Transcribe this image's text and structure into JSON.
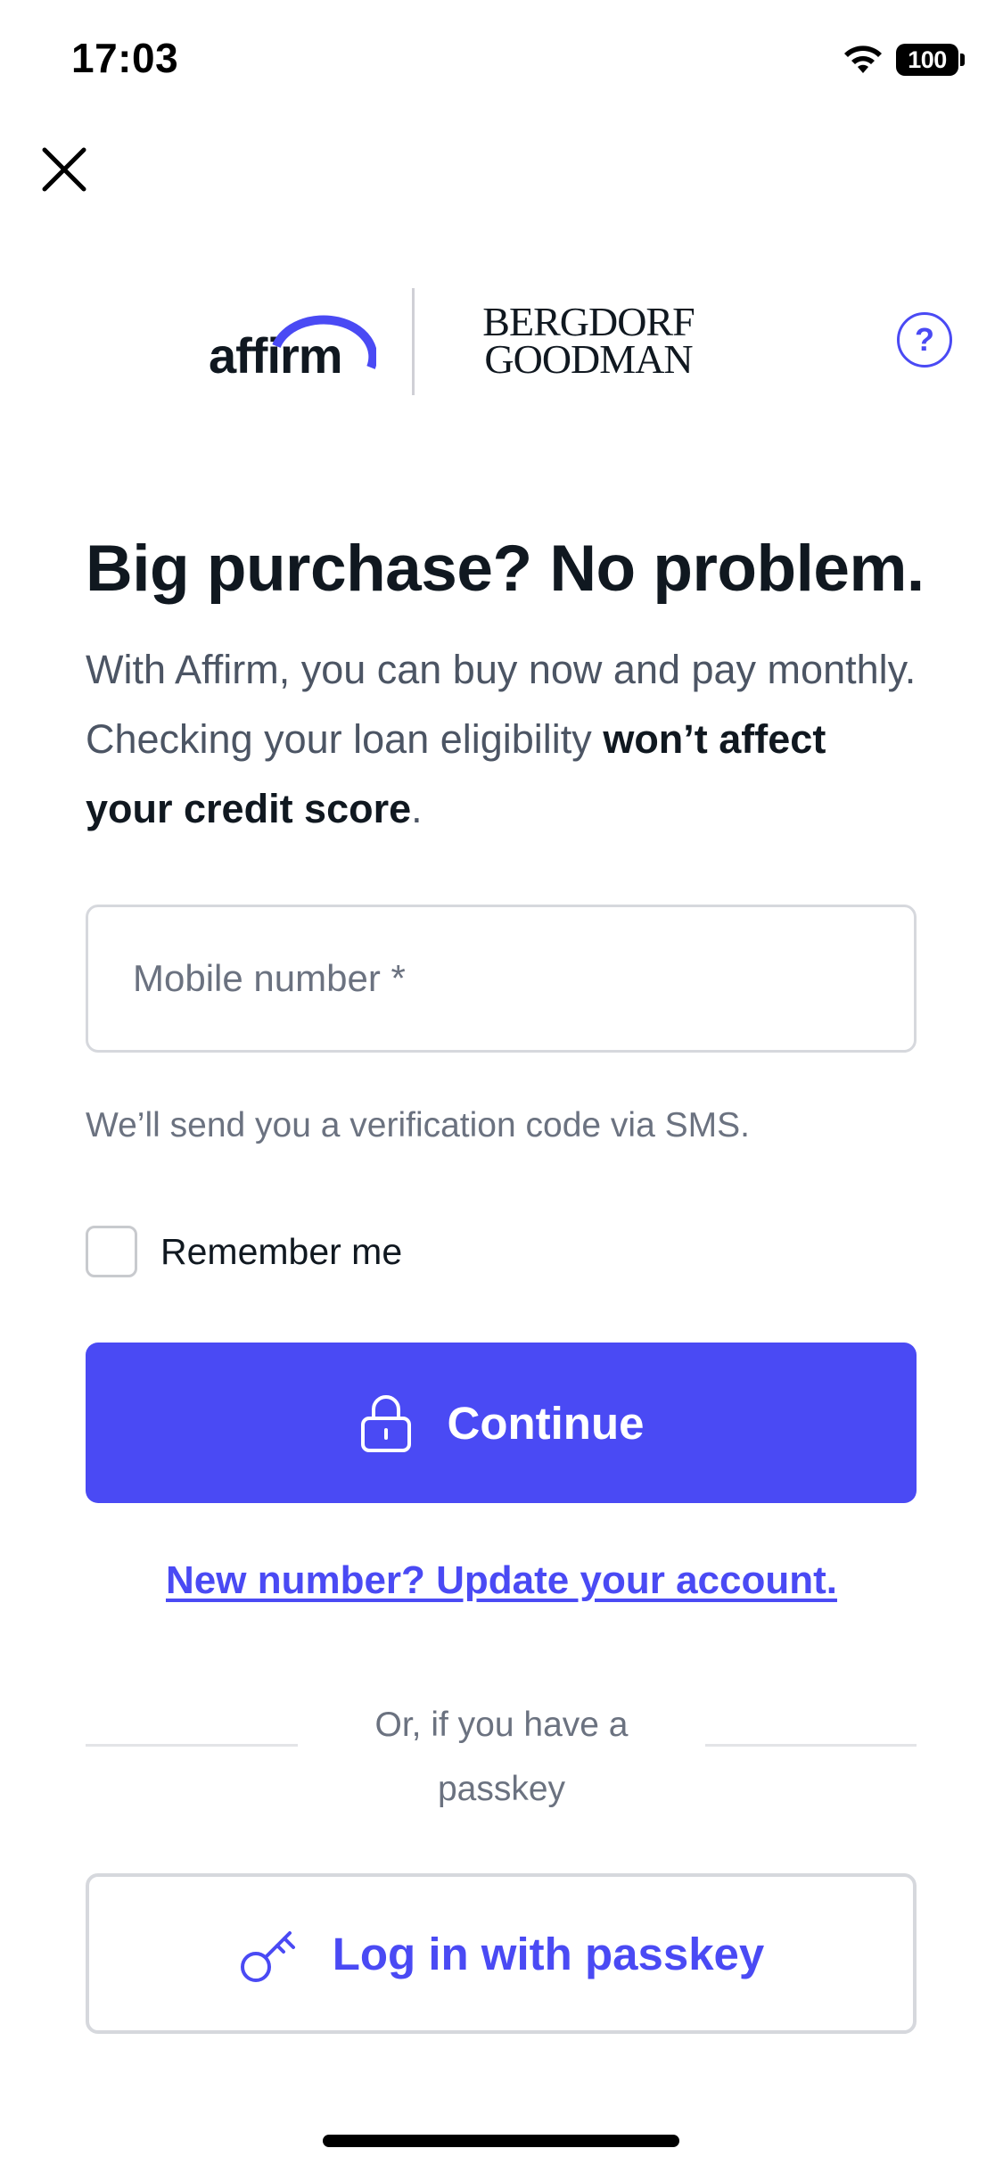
{
  "status_bar": {
    "time": "17:03",
    "battery": "100",
    "icons": [
      "wifi-icon",
      "battery-icon"
    ]
  },
  "header": {
    "close_icon": "close-icon",
    "brand_logo_text": "affirm",
    "merchant_logo_line1": "BERGDORF",
    "merchant_logo_line2": "GOODMAN",
    "help_label": "?"
  },
  "main": {
    "heading": "Big purchase? No problem.",
    "intro_plain": "With Affirm, you can buy now and pay monthly. Checking your loan eligibility ",
    "intro_bold": "won’t affect your credit score",
    "intro_end": ".",
    "phone_input": {
      "placeholder": "Mobile number *",
      "value": ""
    },
    "helper_text": "We’ll send you a verification code via SMS.",
    "remember_label": "Remember me",
    "remember_checked": false,
    "continue_label": "Continue",
    "update_link": "New number? Update your account.",
    "divider_text": "Or, if you have a passkey",
    "passkey_label": "Log in with passkey"
  },
  "colors": {
    "accent": "#4a4af4",
    "text_primary": "#101820",
    "text_secondary": "#6b7280",
    "border": "#d6d8dd"
  }
}
